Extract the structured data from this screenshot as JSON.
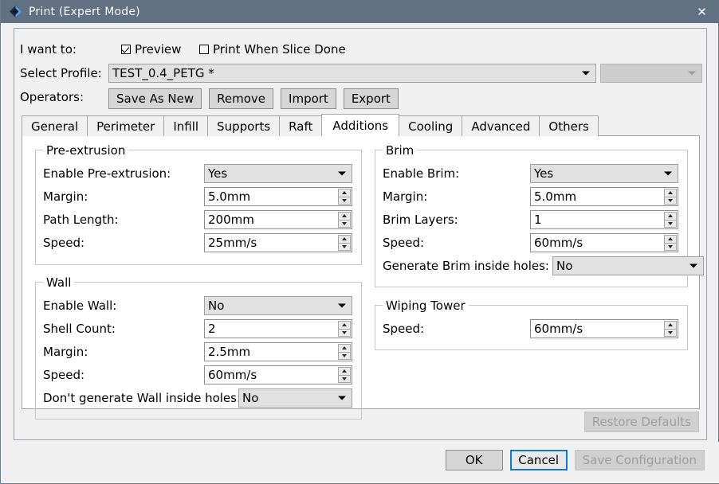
{
  "window": {
    "title": "Print (Expert Mode)",
    "icon": "diamond-logo-icon",
    "close_label": "✕"
  },
  "form": {
    "i_want_to_label": "I want to:",
    "checkboxes": [
      {
        "label": "Preview",
        "checked": true
      },
      {
        "label": "Print When Slice Done",
        "checked": false
      }
    ],
    "select_profile_label": "Select Profile:",
    "profile_value": "TEST_0.4_PETG *",
    "secondary_combo_value": "",
    "operators_label": "Operators:",
    "operator_buttons": [
      {
        "label": "Save As New",
        "disabled": false
      },
      {
        "label": "Remove",
        "disabled": false
      },
      {
        "label": "Import",
        "disabled": false
      },
      {
        "label": "Export",
        "disabled": false
      }
    ]
  },
  "tabs": [
    {
      "label": "General",
      "active": false
    },
    {
      "label": "Perimeter",
      "active": false
    },
    {
      "label": "Infill",
      "active": false
    },
    {
      "label": "Supports",
      "active": false
    },
    {
      "label": "Raft",
      "active": false
    },
    {
      "label": "Additions",
      "active": true
    },
    {
      "label": "Cooling",
      "active": false
    },
    {
      "label": "Advanced",
      "active": false
    },
    {
      "label": "Others",
      "active": false
    }
  ],
  "groups": {
    "pre_extrusion": {
      "legend": "Pre-extrusion",
      "fields": [
        {
          "label": "Enable Pre-extrusion:",
          "type": "combo",
          "value": "Yes"
        },
        {
          "label": "Margin:",
          "type": "spin",
          "value": "5.0mm"
        },
        {
          "label": "Path Length:",
          "type": "spin",
          "value": "200mm"
        },
        {
          "label": "Speed:",
          "type": "spin",
          "value": "25mm/s"
        }
      ]
    },
    "wall": {
      "legend": "Wall",
      "fields": [
        {
          "label": "Enable Wall:",
          "type": "combo",
          "value": "No"
        },
        {
          "label": "Shell Count:",
          "type": "spin",
          "value": "2"
        },
        {
          "label": "Margin:",
          "type": "spin",
          "value": "2.5mm"
        },
        {
          "label": "Speed:",
          "type": "spin",
          "value": "60mm/s"
        },
        {
          "label": "Don't generate Wall inside holes:",
          "type": "combo-wide",
          "value": "No"
        }
      ]
    },
    "brim": {
      "legend": "Brim",
      "fields": [
        {
          "label": "Enable Brim:",
          "type": "combo",
          "value": "Yes"
        },
        {
          "label": "Margin:",
          "type": "spin",
          "value": "5.0mm"
        },
        {
          "label": "Brim Layers:",
          "type": "spin",
          "value": "1"
        },
        {
          "label": "Speed:",
          "type": "spin",
          "value": "60mm/s"
        },
        {
          "label": "Generate Brim inside holes:",
          "type": "combo-wide",
          "value": "No"
        }
      ]
    },
    "wiping_tower": {
      "legend": "Wiping Tower",
      "fields": [
        {
          "label": "Speed:",
          "type": "spin",
          "value": "60mm/s"
        }
      ]
    }
  },
  "footer": {
    "restore_defaults": {
      "label": "Restore Defaults",
      "disabled": true
    },
    "buttons": [
      {
        "label": "OK",
        "disabled": false,
        "focused": false
      },
      {
        "label": "Cancel",
        "disabled": false,
        "focused": true
      },
      {
        "label": "Save Configuration",
        "disabled": true,
        "focused": false
      }
    ]
  },
  "colors": {
    "titlebar": "#5f7183",
    "dialog_bg": "#f0f0f0",
    "panel_bg": "#ffffff",
    "focus_blue": "#0a7ada",
    "combo_bg": "#e1e1e1",
    "disabled_text": "#9e9e9e"
  }
}
